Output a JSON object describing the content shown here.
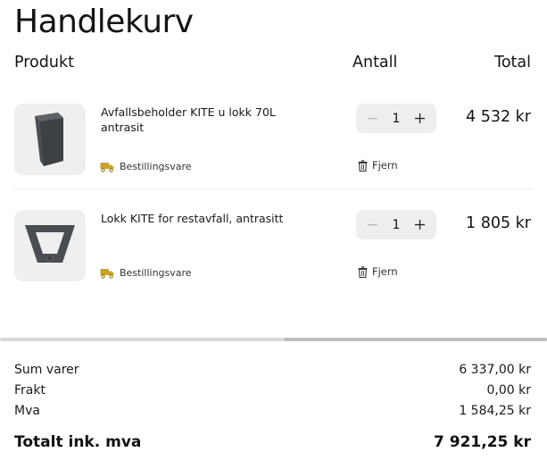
{
  "page": {
    "title": "Handlekurv"
  },
  "columns": {
    "product": "Produkt",
    "quantity": "Antall",
    "total": "Total"
  },
  "items": [
    {
      "name": "Avfallsbeholder KITE u lokk 70L antrasit",
      "badge": "Bestillingsvare",
      "quantity": "1",
      "remove_label": "Fjern",
      "price": "4 532 kr",
      "image_icon": "waste-bin-icon"
    },
    {
      "name": "Lokk KITE for restavfall, antrasitt",
      "badge": "Bestillingsvare",
      "quantity": "1",
      "remove_label": "Fjern",
      "price": "1 805 kr",
      "image_icon": "bin-lid-icon"
    }
  ],
  "summary": {
    "subtotal_label": "Sum varer",
    "subtotal_value": "6 337,00 kr",
    "shipping_label": "Frakt",
    "shipping_value": "0,00 kr",
    "vat_label": "Mva",
    "vat_value": "1 584,25 kr",
    "total_label": "Totalt ink. mva",
    "total_value": "7 921,25 kr"
  },
  "colors": {
    "accent_truck": "#c9a227",
    "text": "#141414",
    "stepper_bg": "#eeeeee"
  }
}
